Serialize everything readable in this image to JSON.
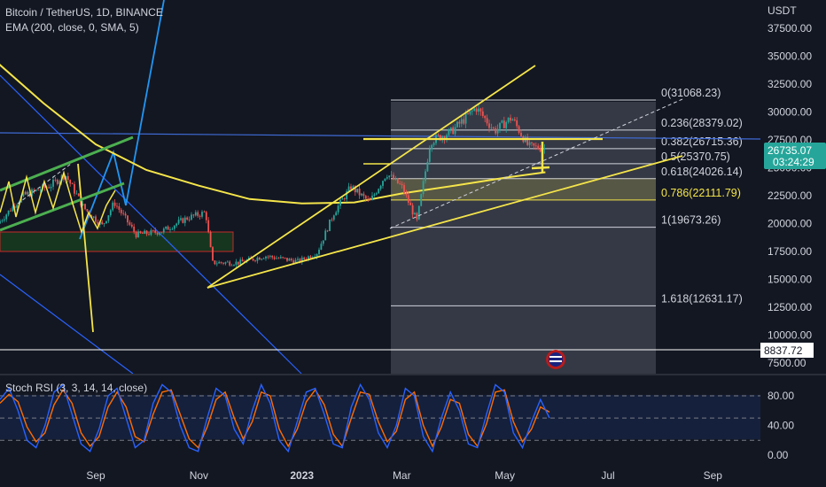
{
  "header": {
    "symbol_line": "Bitcoin / TetherUS, 1D, BINANCE",
    "indicator_line": "EMA (200, close, 0, SMA, 5)"
  },
  "stoch_label": "Stoch RSI (3, 3, 14, 14, close)",
  "currency": "USDT",
  "colors": {
    "background": "#131722",
    "price_badge": "#26a69a",
    "drawing_yellow": "#f5e54a",
    "trend_blue": "#2962ff",
    "stoch_k": "#2962ff",
    "stoch_d": "#ff6d00"
  },
  "icons": {
    "flag": "us-flag-icon"
  },
  "chart_data": [
    {
      "type": "line",
      "title": "Bitcoin / TetherUS, 1D, BINANCE",
      "y_axis_ticks": [
        "37500.00",
        "35000.00",
        "32500.00",
        "30000.00",
        "27500.00",
        "25000.00",
        "22500.00",
        "20000.00",
        "17500.00",
        "15000.00",
        "12500.00",
        "10000.00",
        "7500.00"
      ],
      "ylim": [
        6500,
        39500
      ],
      "x_axis_ticks": [
        "Sep",
        "Nov",
        "2023",
        "Mar",
        "May",
        "Jul",
        "Sep"
      ],
      "last_price": "26735.07",
      "countdown": "03:24:29",
      "horizontal_line_price": "8837.72",
      "scale": "linear",
      "grid": false,
      "fibonacci": [
        {
          "ratio": "0",
          "price": "31068.23",
          "label": "0(31068.23)"
        },
        {
          "ratio": "0.236",
          "price": "28379.02",
          "label": "0.236(28379.02)"
        },
        {
          "ratio": "0.382",
          "price": "26715.36",
          "label": "0.382(26715.36)"
        },
        {
          "ratio": "0.5",
          "price": "25370.75",
          "label": "0.5(25370.75)"
        },
        {
          "ratio": "0.618",
          "price": "24026.14",
          "label": "0.618(24026.14)"
        },
        {
          "ratio": "0.786",
          "price": "22111.79",
          "label": "0.786(22111.79)"
        },
        {
          "ratio": "1",
          "price": "19673.26",
          "label": "1(19673.26)"
        },
        {
          "ratio": "1.618",
          "price": "12631.17",
          "label": "1.618(12631.17)"
        }
      ],
      "ema200": {
        "x": [
          "2022-07-05",
          "2022-08-01",
          "2022-09-01",
          "2022-10-01",
          "2022-11-01",
          "2022-12-01",
          "2023-01-01",
          "2023-02-01",
          "2023-03-01",
          "2023-04-01",
          "2023-05-01",
          "2023-05-25"
        ],
        "y": [
          34400,
          30800,
          27100,
          24800,
          23400,
          22200,
          21800,
          21900,
          22700,
          23400,
          24100,
          24600
        ]
      },
      "price": {
        "x": [
          "2022-07-05",
          "2022-07-20",
          "2022-08-05",
          "2022-08-14",
          "2022-08-25",
          "2022-09-05",
          "2022-09-12",
          "2022-09-25",
          "2022-10-10",
          "2022-10-25",
          "2022-11-05",
          "2022-11-09",
          "2022-11-25",
          "2022-12-10",
          "2022-12-30",
          "2023-01-10",
          "2023-01-20",
          "2023-01-30",
          "2023-02-10",
          "2023-02-20",
          "2023-03-01",
          "2023-03-10",
          "2023-03-18",
          "2023-03-30",
          "2023-04-10",
          "2023-04-14",
          "2023-04-25",
          "2023-05-05",
          "2023-05-15",
          "2023-05-25"
        ],
        "y": [
          20000,
          22500,
          23400,
          24400,
          21400,
          19800,
          21900,
          19000,
          19300,
          20500,
          21000,
          16500,
          16500,
          17100,
          16600,
          17400,
          21000,
          23300,
          21900,
          24500,
          23300,
          20200,
          27400,
          28200,
          29800,
          30400,
          28300,
          29500,
          26900,
          26735
        ]
      },
      "annotations": [
        "ascending wedge",
        "fibonacci retracement",
        "supply zone"
      ]
    },
    {
      "type": "line",
      "title": "Stoch RSI (3, 3, 14, 14, close)",
      "y_axis_ticks": [
        "80.00",
        "40.00",
        "0.00"
      ],
      "bands": [
        80,
        50,
        20
      ],
      "ylim": [
        -10,
        100
      ],
      "series": [
        {
          "values": [
            75,
            90,
            60,
            20,
            10,
            40,
            85,
            95,
            55,
            15,
            5,
            35,
            80,
            90,
            50,
            10,
            20,
            70,
            95,
            85,
            40,
            10,
            5,
            50,
            90,
            80,
            35,
            15,
            60,
            95,
            70,
            20,
            5,
            45,
            85,
            90,
            55,
            15,
            10,
            65,
            95,
            75,
            30,
            10,
            40,
            90,
            80,
            25,
            5,
            50,
            85,
            60,
            15,
            10,
            55,
            95,
            85,
            30,
            10,
            45,
            75,
            50
          ]
        },
        {
          "values": [
            70,
            82,
            72,
            38,
            18,
            30,
            68,
            88,
            70,
            30,
            12,
            25,
            65,
            85,
            65,
            25,
            18,
            55,
            85,
            88,
            55,
            22,
            10,
            38,
            75,
            85,
            50,
            22,
            45,
            85,
            80,
            35,
            12,
            35,
            72,
            88,
            68,
            28,
            12,
            50,
            85,
            82,
            45,
            18,
            32,
            75,
            85,
            40,
            12,
            38,
            75,
            70,
            28,
            12,
            42,
            85,
            88,
            45,
            18,
            35,
            65,
            58
          ]
        }
      ]
    }
  ]
}
